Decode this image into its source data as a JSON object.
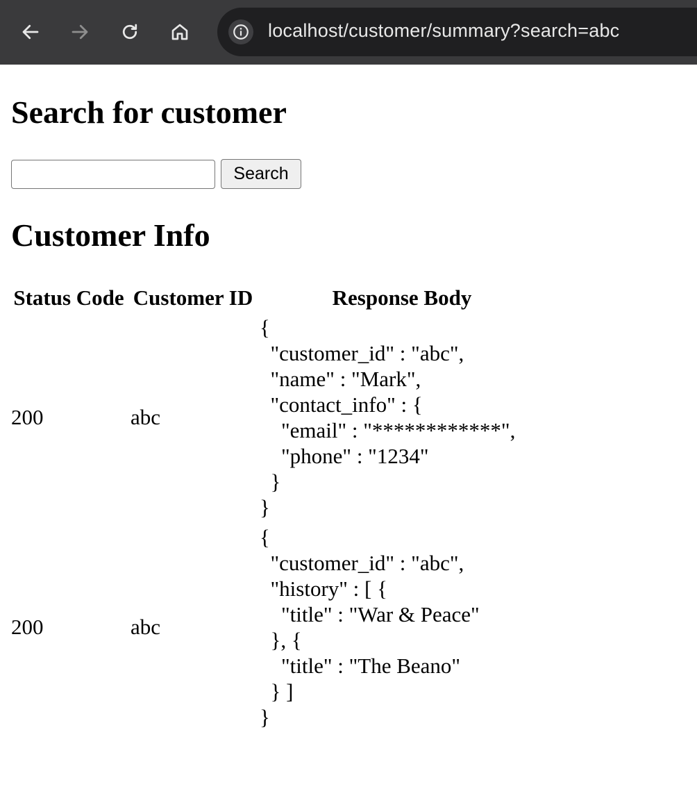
{
  "browser": {
    "url": "localhost/customer/summary?search=abc",
    "back_icon": "arrow-left-icon",
    "forward_icon": "arrow-right-icon",
    "reload_icon": "reload-icon",
    "home_icon": "home-icon",
    "info_icon": "info-icon",
    "colors": {
      "toolbar": "#3a3a3c",
      "address_bar": "#1f1f21",
      "url_text": "#e8e8e8"
    }
  },
  "search_section": {
    "heading": "Search for customer",
    "input_value": "",
    "input_placeholder": "",
    "button_label": "Search"
  },
  "info_section": {
    "heading": "Customer Info"
  },
  "table": {
    "headers": [
      "Status Code",
      "Customer ID",
      "Response Body"
    ],
    "rows": [
      {
        "status_code": "200",
        "customer_id": "abc",
        "response_body": "{\n  \"customer_id\" : \"abc\",\n  \"name\" : \"Mark\",\n  \"contact_info\" : {\n    \"email\" : \"************\",\n    \"phone\" : \"1234\"\n  }\n}"
      },
      {
        "status_code": "200",
        "customer_id": "abc",
        "response_body": "{\n  \"customer_id\" : \"abc\",\n  \"history\" : [ {\n    \"title\" : \"War & Peace\"\n  }, {\n    \"title\" : \"The Beano\"\n  } ]\n}"
      }
    ]
  }
}
